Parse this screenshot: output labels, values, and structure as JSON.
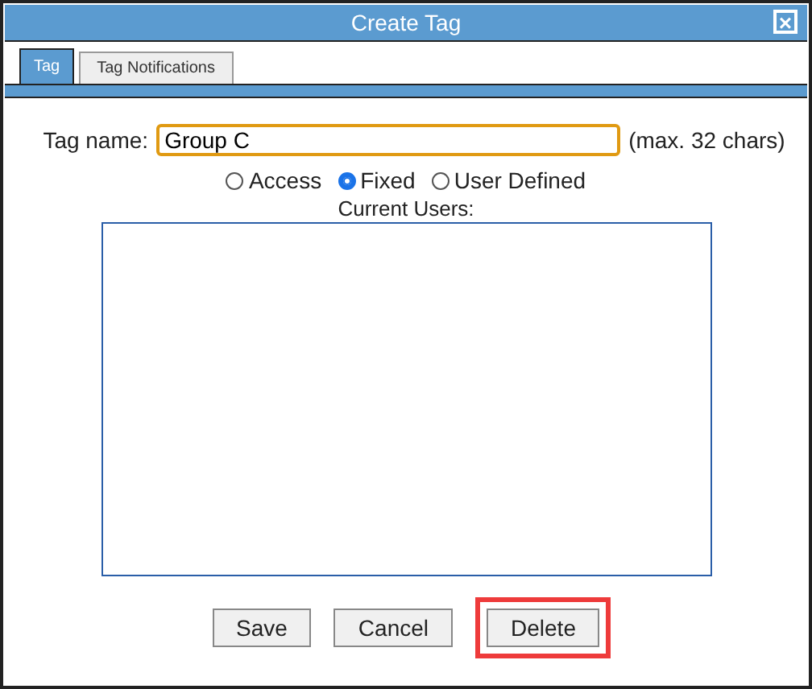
{
  "window": {
    "title": "Create Tag",
    "close": "×"
  },
  "tabs": [
    {
      "label": "Tag",
      "selected": true
    },
    {
      "label": "Tag Notifications",
      "selected": false
    }
  ],
  "tag_name": {
    "label": "Tag name:",
    "value": "Group C",
    "hint": "(max. 32 chars)"
  },
  "tag_types": [
    {
      "label": "Access",
      "selected": false
    },
    {
      "label": "Fixed",
      "selected": true
    },
    {
      "label": "User Defined",
      "selected": false
    }
  ],
  "current_users": {
    "label": "Current Users:"
  },
  "buttons": [
    {
      "label": "Save",
      "highlighted": false
    },
    {
      "label": "Cancel",
      "highlighted": false
    },
    {
      "label": "Delete",
      "highlighted": true
    }
  ]
}
